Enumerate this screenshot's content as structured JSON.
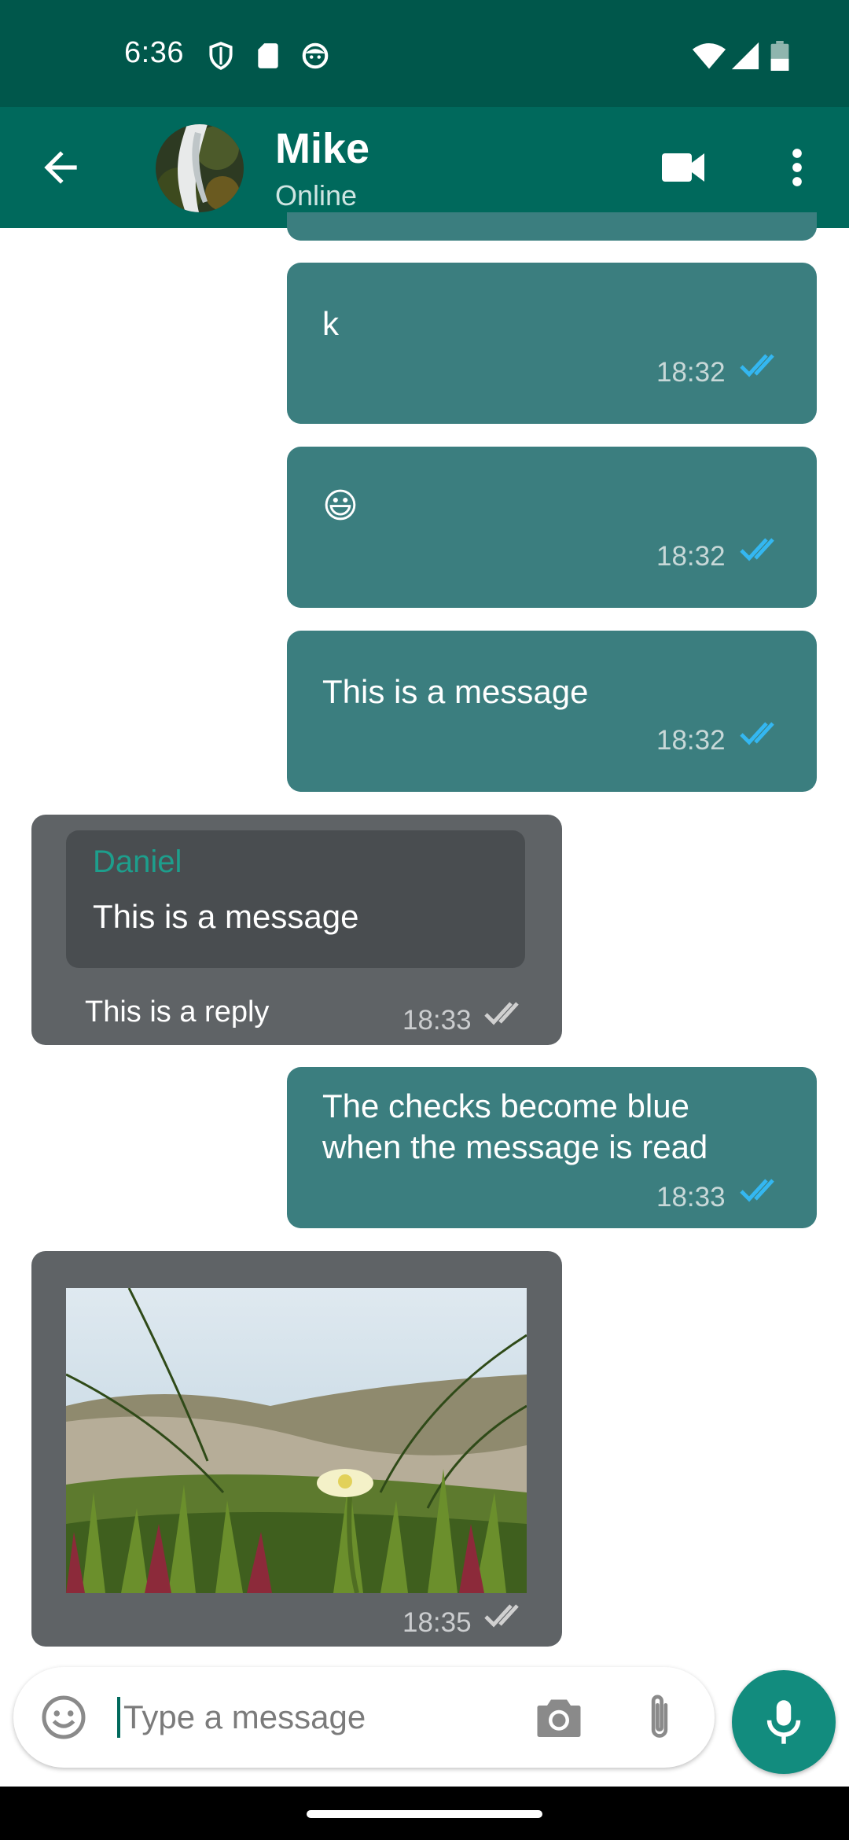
{
  "status_bar": {
    "time": "6:36",
    "icons_left": [
      "shield-icon",
      "sd-card-icon",
      "face-icon"
    ],
    "icons_right": [
      "wifi-icon",
      "cell-signal-icon",
      "battery-icon"
    ]
  },
  "app_bar": {
    "contact_name": "Mike",
    "contact_status": "Online",
    "icons": [
      "arrow-back-icon",
      "videocam-icon",
      "more-vert-icon"
    ]
  },
  "messages": [
    {
      "type": "outgoing",
      "text": "k",
      "time": "18:32",
      "status": "read"
    },
    {
      "type": "outgoing",
      "text": "😃",
      "time": "18:32",
      "status": "read"
    },
    {
      "type": "outgoing",
      "text": "This is a message",
      "time": "18:32",
      "status": "read"
    },
    {
      "type": "incoming_reply",
      "quoted_author": "Daniel",
      "quoted_text": "This is a message",
      "text": "This is a reply",
      "time": "18:33",
      "status": "delivered"
    },
    {
      "type": "outgoing",
      "text_line1": "The checks become blue",
      "text_line2": "when the message is read",
      "time": "18:33",
      "status": "read"
    },
    {
      "type": "incoming_image",
      "time": "18:35",
      "status": "delivered"
    }
  ],
  "input": {
    "placeholder": "Type a message",
    "icons": [
      "emoji-icon",
      "camera-icon",
      "attach-icon",
      "mic-icon"
    ]
  },
  "colors": {
    "status_bar": "#00574b",
    "app_bar": "#00695c",
    "outgoing_bubble": "#3b7e7f",
    "incoming_bubble": "#5f6366",
    "quote_bubble": "#494d50",
    "read_ticks": "#34b7f1",
    "delivered_ticks": "#d0d0d0",
    "quote_author": "#1d9e8c",
    "mic_fab": "#128c7e"
  }
}
